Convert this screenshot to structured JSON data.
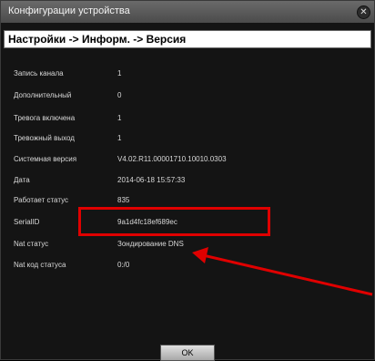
{
  "window": {
    "title": "Конфигурации устройства",
    "close_glyph": "✕"
  },
  "breadcrumb": "Настройки -> Информ. -> Версия",
  "rows": [
    {
      "label": "Запись канала",
      "value": "1"
    },
    {
      "label": "Дополнительный",
      "value": "0"
    },
    {
      "label": "Тревога включена",
      "value": "1"
    },
    {
      "label": "Тревожный выход",
      "value": "1"
    },
    {
      "label": "Системная версия",
      "value": "V4.02.R11.00001710.10010.0303"
    },
    {
      "label": "Дата",
      "value": "2014-06-18 15:57:33"
    },
    {
      "label": "Работает статус",
      "value": "835"
    },
    {
      "label": "SerialID",
      "value": "9a1d4fc18ef689ec"
    },
    {
      "label": "Nat статус",
      "value": "Зондирование DNS"
    },
    {
      "label": "Nat код статуса",
      "value": "0:/0"
    }
  ],
  "ok_label": "OK",
  "colors": {
    "highlight": "#e00000",
    "arrow": "#e00000"
  }
}
